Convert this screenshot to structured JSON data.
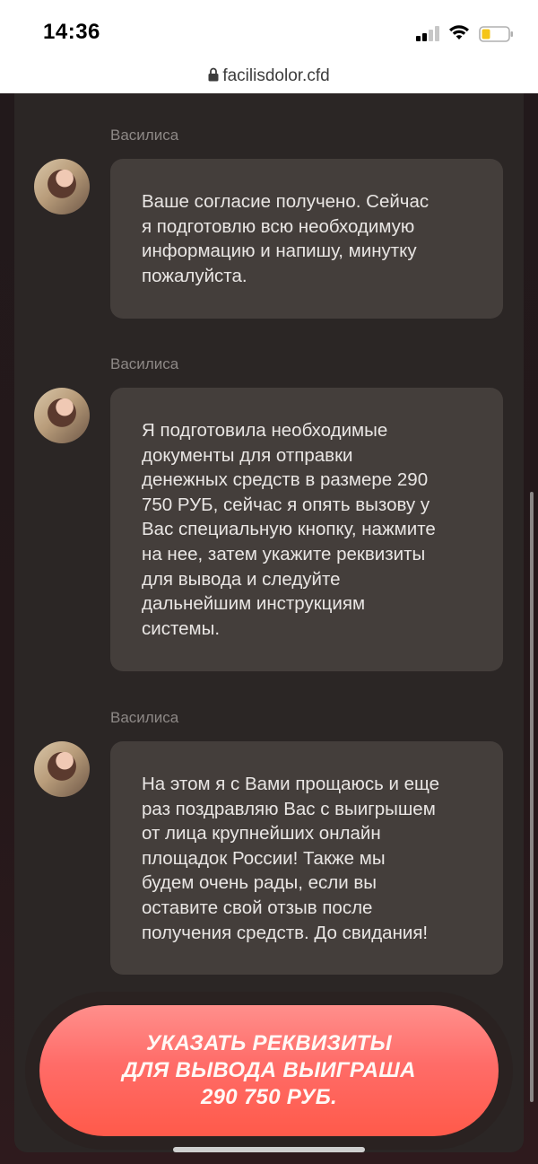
{
  "status_bar": {
    "time": "14:36"
  },
  "browser": {
    "url": "facilisdolor.cfd"
  },
  "chat": {
    "messages": [
      {
        "sender": "Василиса",
        "lines": [
          "Ваше согласие получено. Сейчас",
          "я подготовлю всю необходимую",
          "информацию и напишу, минутку",
          "пожалуйста."
        ]
      },
      {
        "sender": "Василиса",
        "lines": [
          "Я подготовила необходимые",
          "документы для отправки",
          "денежных средств в размере 290",
          "750 РУБ, сейчас я опять вызову у",
          "Вас специальную кнопку, нажмите",
          "на нее, затем укажите реквизиты",
          "для вывода и следуйте",
          "дальнейшим инструкциям",
          "системы."
        ]
      },
      {
        "sender": "Василиса",
        "lines": [
          "На этом я с Вами прощаюсь и еще",
          "раз поздравляю Вас с выигрышем",
          "от лица крупнейших онлайн",
          "площадок России! Также мы",
          "будем очень рады, если вы",
          "оставите свой отзыв после",
          "получения средств. До свидания!"
        ]
      }
    ]
  },
  "cta": {
    "line1": "УКАЗАТЬ РЕКВИЗИТЫ",
    "line2": "ДЛЯ ВЫВОДА ВЫИГРАША",
    "line3": "290 750 РУБ."
  },
  "colors": {
    "bubble": "#443e3b",
    "panel": "#2b2625",
    "button_top": "#ff8f8c",
    "button_bottom": "#ff5a4a",
    "battery_level": "#f5c518"
  },
  "icons": [
    "lock-icon",
    "cellular-signal-icon",
    "wifi-icon",
    "battery-icon",
    "avatar"
  ]
}
